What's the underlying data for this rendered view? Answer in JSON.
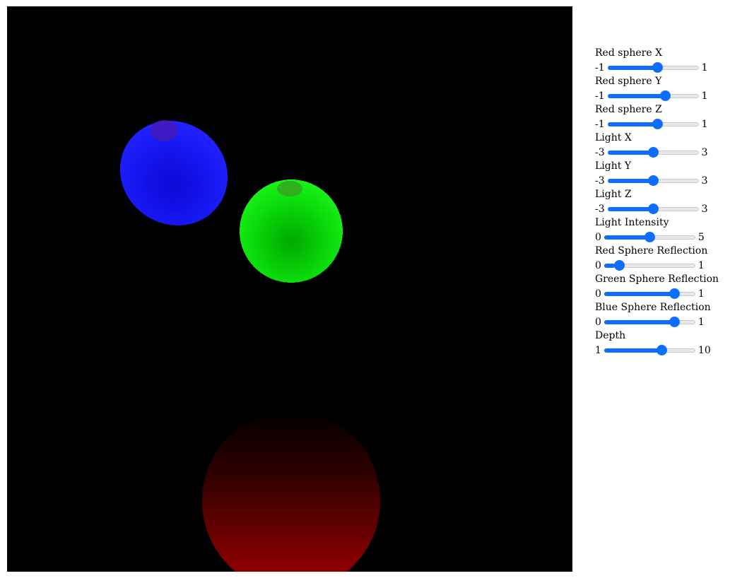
{
  "scene": {
    "background_color": "#000000",
    "spheres": [
      {
        "name": "blue-sphere",
        "color": "#1a1aff"
      },
      {
        "name": "green-sphere",
        "color": "#10e010"
      },
      {
        "name": "red-sphere",
        "color": "#a00000"
      }
    ]
  },
  "controls": [
    {
      "id": "red-sphere-x",
      "label": "Red sphere X",
      "min": "-1",
      "max": "1",
      "value": 0.1
    },
    {
      "id": "red-sphere-y",
      "label": "Red sphere Y",
      "min": "-1",
      "max": "1",
      "value": 0.3
    },
    {
      "id": "red-sphere-z",
      "label": "Red sphere Z",
      "min": "-1",
      "max": "1",
      "value": 0.1
    },
    {
      "id": "light-x",
      "label": "Light X",
      "min": "-3",
      "max": "3",
      "value": 0
    },
    {
      "id": "light-y",
      "label": "Light Y",
      "min": "-3",
      "max": "3",
      "value": 0
    },
    {
      "id": "light-z",
      "label": "Light Z",
      "min": "-3",
      "max": "3",
      "value": 0
    },
    {
      "id": "light-intensity",
      "label": "Light Intensity",
      "min": "0",
      "max": "5",
      "value": 2.5
    },
    {
      "id": "red-sphere-reflection",
      "label": "Red Sphere Reflection",
      "min": "0",
      "max": "1",
      "value": 0.12
    },
    {
      "id": "green-sphere-reflection",
      "label": "Green Sphere Reflection",
      "min": "0",
      "max": "1",
      "value": 0.8
    },
    {
      "id": "blue-sphere-reflection",
      "label": "Blue Sphere Reflection",
      "min": "0",
      "max": "1",
      "value": 0.8
    },
    {
      "id": "depth",
      "label": "Depth",
      "min": "1",
      "max": "10",
      "value": 6.8
    }
  ],
  "slider_color": "#0d6efd"
}
